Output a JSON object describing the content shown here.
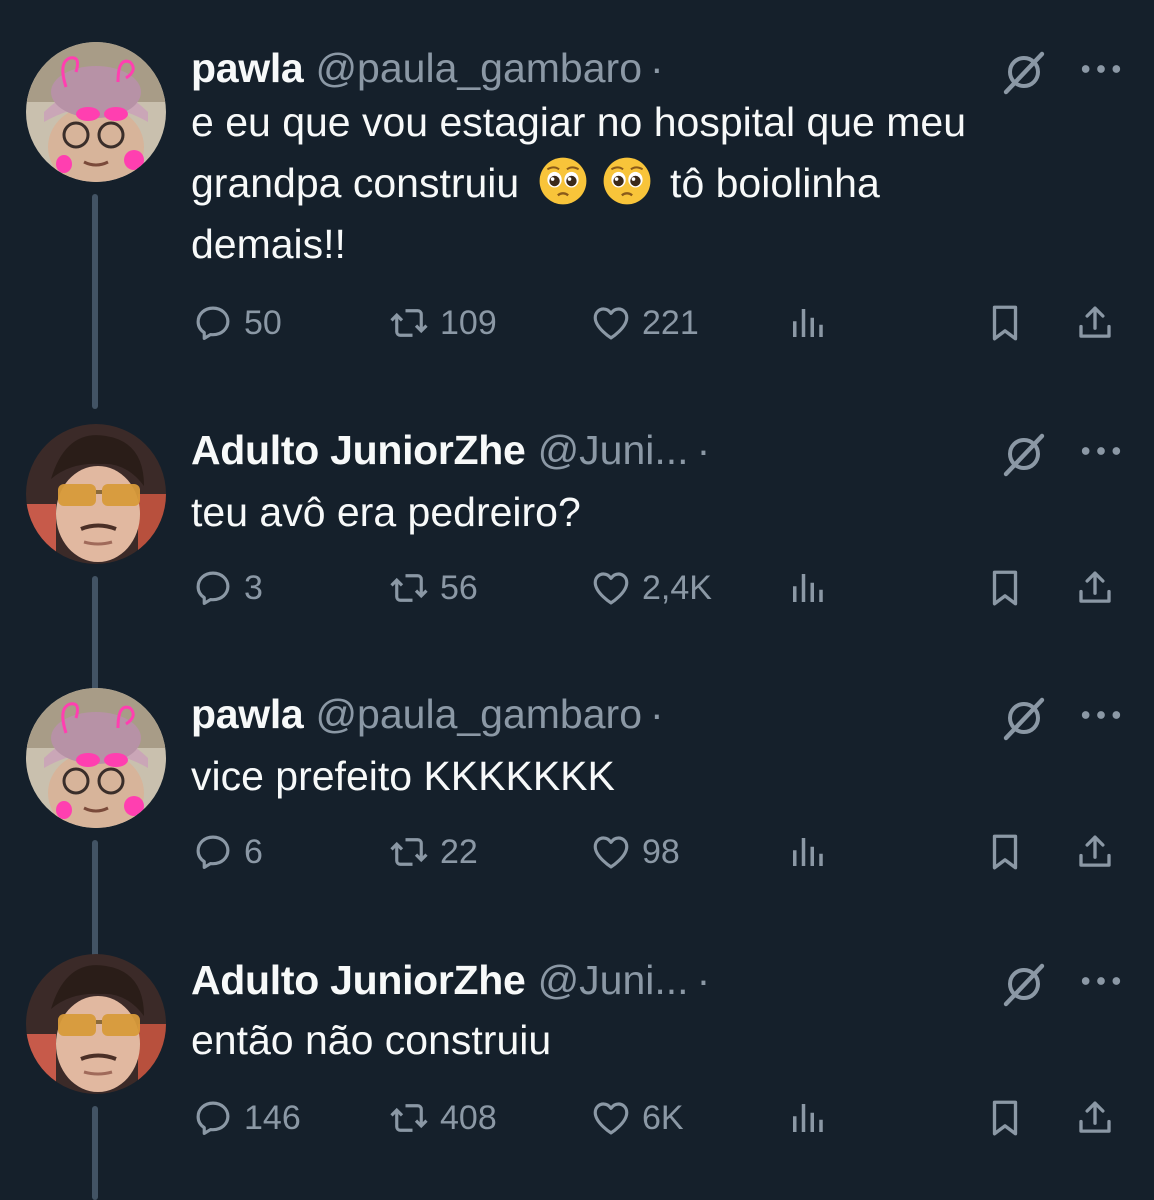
{
  "tweets": [
    {
      "name": "pawla",
      "handle": "@paula_gambaro",
      "dot": "·",
      "text_line1": "e eu que vou estagiar no hospital que meu",
      "text_line2_a": "grandpa construiu",
      "text_line2_b": "tô boiolinha",
      "text_line3": "demais!!",
      "emoji": "pleading-face",
      "replies": "50",
      "retweets": "109",
      "likes": "221"
    },
    {
      "name": "Adulto JuniorZhe",
      "handle": "@Juni...",
      "dot": "·",
      "text": "teu avô era pedreiro?",
      "replies": "3",
      "retweets": "56",
      "likes": "2,4K"
    },
    {
      "name": "pawla",
      "handle": "@paula_gambaro",
      "dot": "·",
      "text": "vice prefeito KKKKKKK",
      "replies": "6",
      "retweets": "22",
      "likes": "98"
    },
    {
      "name": "Adulto JuniorZhe",
      "handle": "@Juni...",
      "dot": "·",
      "text": "então não construiu",
      "replies": "146",
      "retweets": "408",
      "likes": "6K"
    }
  ],
  "colors": {
    "background": "#15202b",
    "text": "#f7f9f9",
    "muted": "#8b98a5",
    "thread_line": "#425364"
  },
  "icons": [
    "reply-icon",
    "retweet-icon",
    "like-icon",
    "views-icon",
    "bookmark-icon",
    "share-icon",
    "grok-icon",
    "more-icon"
  ]
}
